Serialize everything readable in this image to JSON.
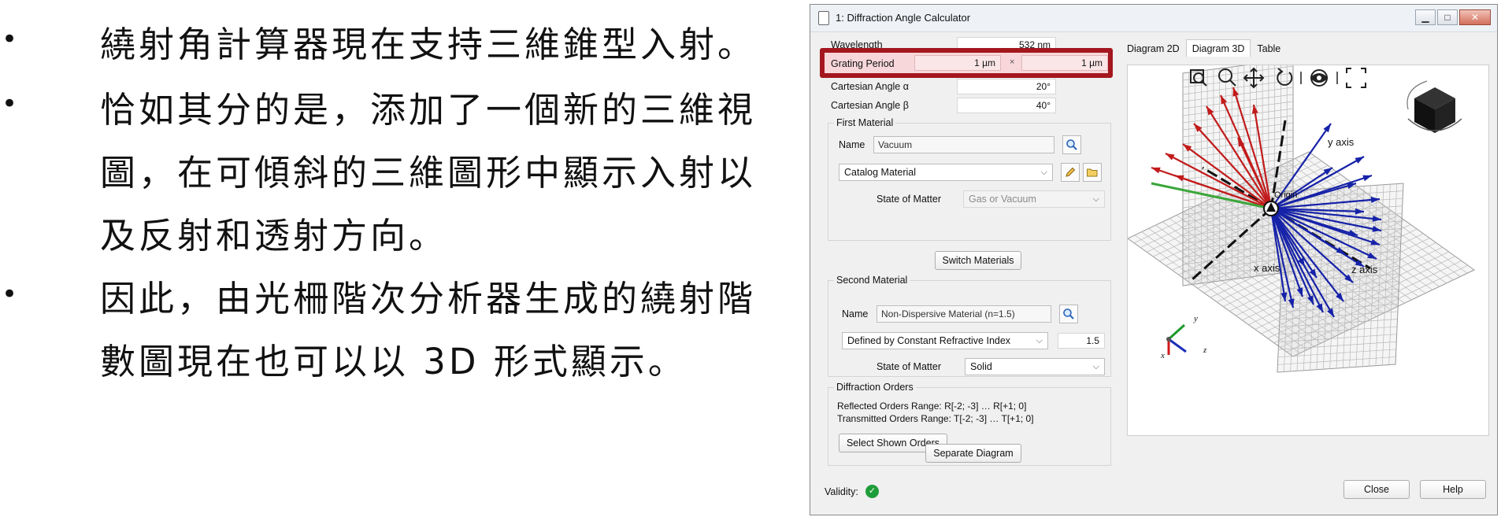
{
  "bullets": [
    "繞射角計算器現在支持三維錐型入射。",
    "恰如其分的是，添加了一個新的三維視",
    "圖，在可傾斜的三維圖形中顯示入射以",
    "及反射和透射方向。",
    "因此，由光柵階次分析器生成的繞射階",
    "數圖現在也可以以 3D 形式顯示。"
  ],
  "bullet_marks": [
    "•",
    "•",
    "•"
  ],
  "window": {
    "title": "1: Diffraction Angle Calculator",
    "controls": {
      "minimize": "▁",
      "maximize": "□",
      "close": "✕"
    }
  },
  "form": {
    "wavelength": {
      "label": "Wavelength",
      "value": "532 nm"
    },
    "grating_period": {
      "label": "Grating Period",
      "x": "1 µm",
      "sep": "×",
      "y": "1 µm"
    },
    "angle_alpha": {
      "label": "Cartesian Angle α",
      "value": "20°"
    },
    "angle_beta": {
      "label": "Cartesian Angle β",
      "value": "40°"
    }
  },
  "first_material": {
    "title": "First Material",
    "name_label": "Name",
    "name_value": "Vacuum",
    "type": "Catalog Material",
    "state_label": "State of Matter",
    "state_value": "Gas or Vacuum"
  },
  "switch_button": "Switch Materials",
  "second_material": {
    "title": "Second Material",
    "name_label": "Name",
    "name_value": "Non-Dispersive Material (n=1.5)",
    "type": "Defined by Constant Refractive Index",
    "index_value": "1.5",
    "state_label": "State of Matter",
    "state_value": "Solid"
  },
  "diffraction_orders": {
    "title": "Diffraction Orders",
    "reflected": "Reflected Orders Range: R[-2; -3] … R[+1; 0]",
    "transmitted": "Transmitted Orders Range: T[-2; -3] … T[+1; 0]",
    "select_button": "Select Shown Orders"
  },
  "tabs": [
    "Diagram 2D",
    "Diagram 3D",
    "Table"
  ],
  "active_tab": "Diagram 3D",
  "diagram": {
    "labels": {
      "y_axis": "y axis",
      "x_axis": "x axis",
      "z_axis": "z axis",
      "origin": "Origin"
    },
    "triad": {
      "x": "x",
      "y": "y",
      "z": "z"
    },
    "toolbar_icons": [
      "zoom-window-icon",
      "zoom-icon",
      "pan-icon",
      "rotate-icon",
      "view-icon",
      "fit-icon"
    ]
  },
  "separate_button": "Separate Diagram",
  "validity_label": "Validity:",
  "validity_mark": "✓",
  "close_button": "Close",
  "help_button": "Help",
  "colors": {
    "highlight": "#a4171e",
    "reflected": "#c21b1b",
    "transmitted": "#1622a8",
    "incident": "#3aa63a"
  }
}
